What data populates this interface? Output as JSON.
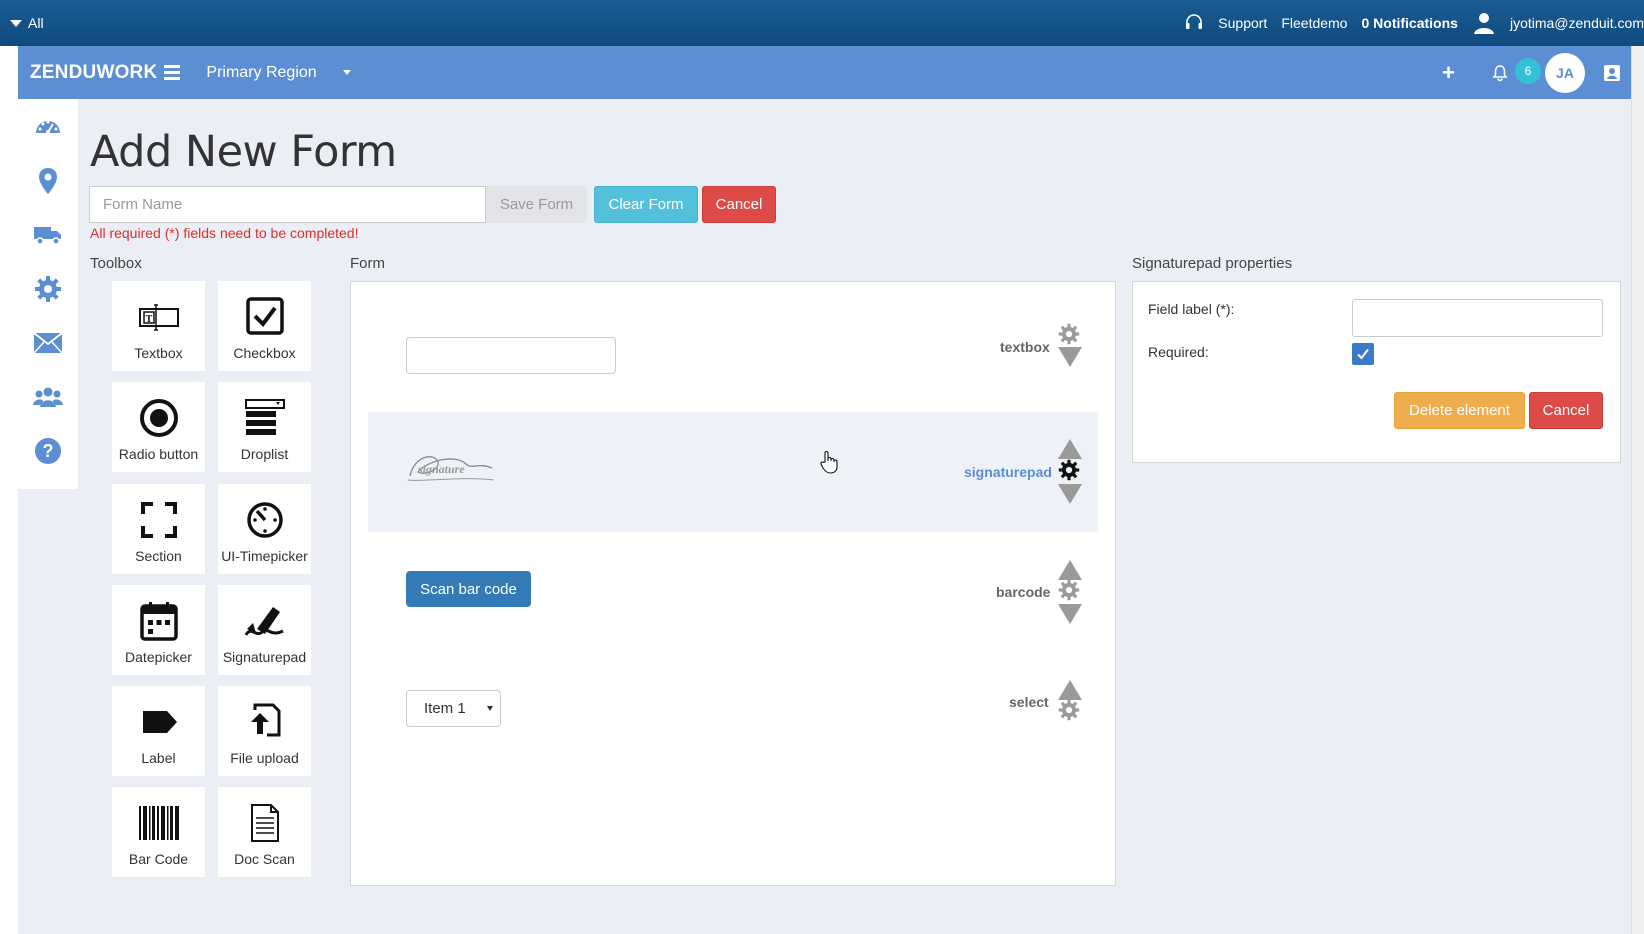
{
  "topbar": {
    "scope": "All",
    "support": "Support",
    "account": "Fleetdemo",
    "notifications": "0 Notifications",
    "email": "jyotima@zenduit.com"
  },
  "header": {
    "brand": "ZENDUWORK",
    "region": "Primary Region",
    "notification_count": "6",
    "user_initials": "JA"
  },
  "page": {
    "title": "Add New Form",
    "form_name_placeholder": "Form Name",
    "save_label": "Save Form",
    "clear_label": "Clear Form",
    "cancel_label": "Cancel",
    "error_message": "All required (*) fields need to be completed!"
  },
  "toolbox": {
    "heading": "Toolbox",
    "items": [
      {
        "label": "Textbox",
        "icon": "textbox-icon"
      },
      {
        "label": "Checkbox",
        "icon": "checkbox-icon"
      },
      {
        "label": "Radio button",
        "icon": "radio-button-icon"
      },
      {
        "label": "Droplist",
        "icon": "droplist-icon"
      },
      {
        "label": "Section",
        "icon": "section-icon"
      },
      {
        "label": "UI-Timepicker",
        "icon": "timepicker-icon"
      },
      {
        "label": "Datepicker",
        "icon": "calendar-icon"
      },
      {
        "label": "Signaturepad",
        "icon": "signature-icon"
      },
      {
        "label": "Label",
        "icon": "tag-icon"
      },
      {
        "label": "File upload",
        "icon": "file-upload-icon"
      },
      {
        "label": "Bar Code",
        "icon": "barcode-icon"
      },
      {
        "label": "Doc Scan",
        "icon": "document-icon"
      }
    ]
  },
  "form": {
    "heading": "Form",
    "elements": [
      {
        "type": "textbox"
      },
      {
        "type": "signaturepad",
        "preview_text": "signature"
      },
      {
        "type": "barcode",
        "button_label": "Scan bar code"
      },
      {
        "type": "select",
        "selected": "Item 1"
      }
    ]
  },
  "properties": {
    "heading": "Signaturepad properties",
    "field_label": "Field label (*):",
    "field_value": "",
    "required_label": "Required:",
    "required_checked": true,
    "delete_label": "Delete element",
    "cancel_label": "Cancel"
  },
  "colors": {
    "topbar": "#0f4a7d",
    "appbar": "#5b8ed3",
    "clear_button": "#55c0dc",
    "cancel_button": "#dc4b47",
    "delete_button": "#f0ad4e",
    "primary_button": "#337ab7"
  }
}
